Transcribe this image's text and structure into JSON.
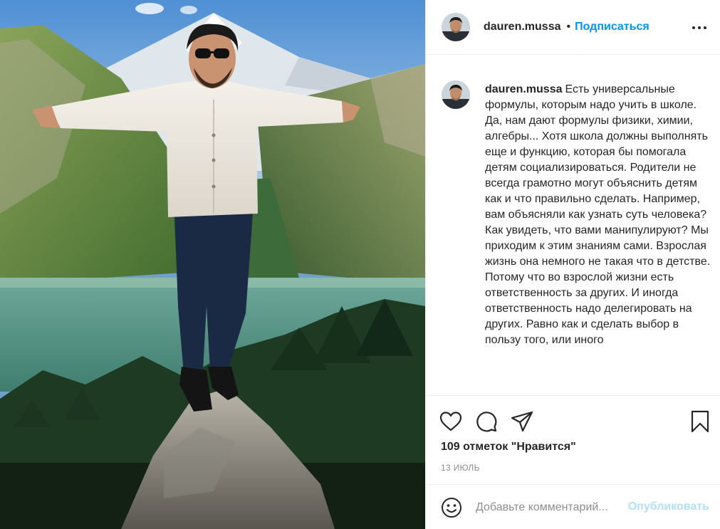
{
  "post": {
    "username": "dauren.mussa",
    "separator": "•",
    "follow_label": "Подписаться",
    "more_icon": "more-horizontal-icon"
  },
  "caption": {
    "username": "dauren.mussa",
    "text": "Есть универсальные формулы, которым надо учить в школе. Да, нам дают формулы физики, химии, алгебры... Хотя школа должны выполнять еще и функцию, которая бы помогала детям социализироваться. Родители не всегда грамотно могут объяснить детям как и что правильно сделать. Например, вам объясняли как узнать суть человека? Как увидеть, что вами манипулируют? Мы приходим к этим знаниям сами. Взрослая жизнь она немного не такая что в детстве. Потому что во взрослой жизни есть ответственность за других. И иногда ответственность надо делегировать на других. Равно как и сделать выбор в пользу того, или иного"
  },
  "actions": {
    "like_icon": "heart-icon",
    "comment_icon": "comment-icon",
    "share_icon": "share-icon",
    "save_icon": "bookmark-icon",
    "likes_text": "109 отметок \"Нравится\"",
    "date": "13 июль"
  },
  "add_comment": {
    "emoji_icon": "emoji-icon",
    "placeholder": "Добавьте комментарий...",
    "post_label": "Опубликовать",
    "post_color": "#b2dffc"
  },
  "colors": {
    "accent": "#0095f6",
    "text": "#262626",
    "muted": "#8e8e8e",
    "border": "#efefef"
  }
}
